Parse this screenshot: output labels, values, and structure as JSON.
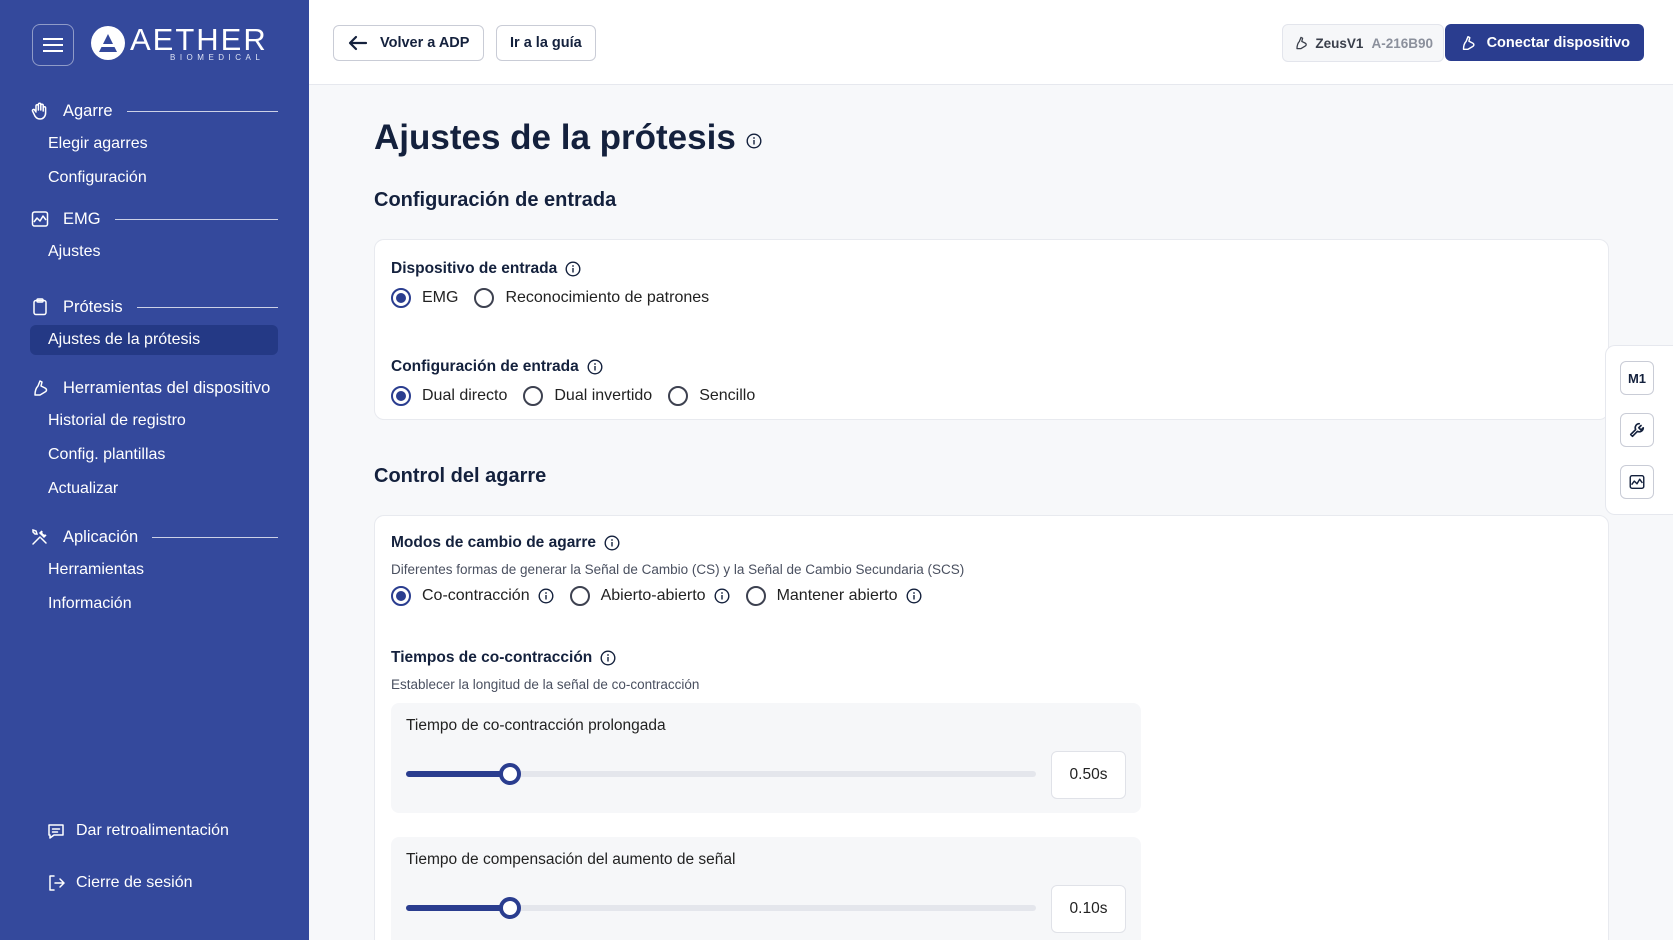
{
  "brand": {
    "name": "AETHER",
    "sub": "BIOMEDICAL"
  },
  "sidebar": {
    "sections": [
      {
        "title": "Agarre",
        "icon": "hand-icon",
        "items": [
          "Elegir agarres",
          "Configuración"
        ]
      },
      {
        "title": "EMG",
        "icon": "emg-chart-icon",
        "items": [
          "Ajustes"
        ]
      },
      {
        "title": "Prótesis",
        "icon": "clipboard-icon",
        "items": [
          "Ajustes de la prótesis"
        ]
      },
      {
        "title": "Herramientas del dispositivo",
        "icon": "prosthesis-icon",
        "items": [
          "Historial de registro",
          "Config. plantillas",
          "Actualizar"
        ]
      },
      {
        "title": "Aplicación",
        "icon": "tools-icon",
        "items": [
          "Herramientas",
          "Información"
        ]
      }
    ],
    "active_item": "Ajustes de la prótesis",
    "feedback": "Dar retroalimentación",
    "logout": "Cierre de sesión"
  },
  "topbar": {
    "back_label": "Volver a ADP",
    "guide_label": "Ir a la guía",
    "device_name": "ZeusV1",
    "device_id": "A-216B90",
    "connect_label": "Conectar dispositivo"
  },
  "main": {
    "title": "Ajustes de la prótesis",
    "input_section": {
      "title": "Configuración de entrada",
      "device_label": "Dispositivo de entrada",
      "device_options": [
        "EMG",
        "Reconocimiento de patrones"
      ],
      "device_selected": "EMG",
      "config_label": "Configuración de entrada",
      "config_options": [
        "Dual directo",
        "Dual invertido",
        "Sencillo"
      ],
      "config_selected": "Dual directo"
    },
    "grip_section": {
      "title": "Control del agarre",
      "modes_label": "Modos de cambio de agarre",
      "modes_desc": "Diferentes formas de generar la Señal de Cambio (CS) y la Señal de Cambio Secundaria (SCS)",
      "modes_options": [
        "Co-contracción",
        "Abierto-abierto",
        "Mantener abierto"
      ],
      "modes_selected": "Co-contracción",
      "times_label": "Tiempos de co-contracción",
      "times_desc": "Establecer la longitud de la señal de co-contracción",
      "sliders": [
        {
          "label": "Tiempo de co-contracción prolongada",
          "value": "0.50s",
          "fraction": 0.165
        },
        {
          "label": "Tiempo de compensación del aumento de señal",
          "value": "0.10s",
          "fraction": 0.165
        }
      ]
    }
  },
  "rail": {
    "m1_label": "M1",
    "buttons": [
      "m1-button",
      "wrench-icon",
      "emg-chart-icon"
    ]
  },
  "colors": {
    "sidebar": "#34499c",
    "sidebar_active": "#243985",
    "primary": "#2a3d8f",
    "text": "#14213d"
  }
}
